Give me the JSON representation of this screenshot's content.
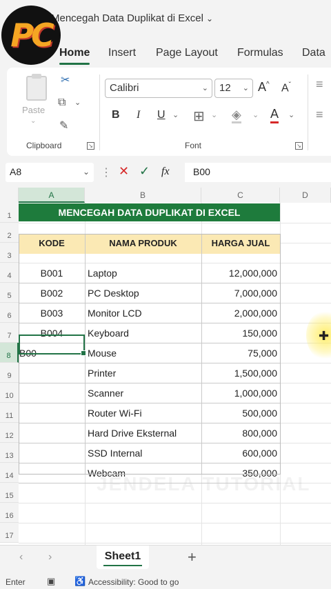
{
  "window": {
    "title": "Mencegah Data Duplikat di Excel",
    "logo_text": "PC"
  },
  "ribbon_tabs": [
    "Home",
    "Insert",
    "Page Layout",
    "Formulas",
    "Data"
  ],
  "ribbon": {
    "clipboard": {
      "label": "Clipboard",
      "paste_label": "Paste"
    },
    "font": {
      "label": "Font",
      "family": "Calibri",
      "size": "12",
      "bold": "B",
      "italic": "I",
      "underline": "U",
      "font_color_letter": "A",
      "grow": "A",
      "shrink": "A"
    }
  },
  "formula_bar": {
    "name_box": "A8",
    "fx": "fx",
    "value": "B00"
  },
  "columns": [
    "A",
    "B",
    "C",
    "D"
  ],
  "rows": [
    "1",
    "2",
    "3",
    "4",
    "5",
    "6",
    "7",
    "8",
    "9",
    "10",
    "11",
    "12",
    "13",
    "14",
    "15",
    "16",
    "17"
  ],
  "sheet": {
    "title": "MENCEGAH DATA DUPLIKAT DI EXCEL",
    "headers": {
      "kode": "KODE",
      "nama": "NAMA PRODUK",
      "harga": "HARGA JUAL"
    },
    "items": [
      {
        "kode": "B001",
        "nama": "Laptop",
        "harga": "12,000,000"
      },
      {
        "kode": "B002",
        "nama": "PC Desktop",
        "harga": "7,000,000"
      },
      {
        "kode": "B003",
        "nama": "Monitor LCD",
        "harga": "2,000,000"
      },
      {
        "kode": "B004",
        "nama": "Keyboard",
        "harga": "150,000"
      },
      {
        "kode": "B00",
        "nama": "Mouse",
        "harga": "75,000"
      },
      {
        "kode": "",
        "nama": "Printer",
        "harga": "1,500,000"
      },
      {
        "kode": "",
        "nama": "Scanner",
        "harga": "1,000,000"
      },
      {
        "kode": "",
        "nama": "Router Wi-Fi",
        "harga": "500,000"
      },
      {
        "kode": "",
        "nama": "Hard Drive Eksternal",
        "harga": "800,000"
      },
      {
        "kode": "",
        "nama": "SSD Internal",
        "harga": "600,000"
      },
      {
        "kode": "",
        "nama": "Webcam",
        "harga": "350,000"
      }
    ],
    "watermark": "JENDELA TUTORIAL"
  },
  "sheet_tabs": {
    "active": "Sheet1",
    "add": "+"
  },
  "status": {
    "mode": "Enter",
    "accessibility": "Accessibility: Good to go"
  },
  "colors": {
    "accent": "#217346",
    "title_fill": "#1e7b3c",
    "header_fill": "#fbe9b4"
  }
}
